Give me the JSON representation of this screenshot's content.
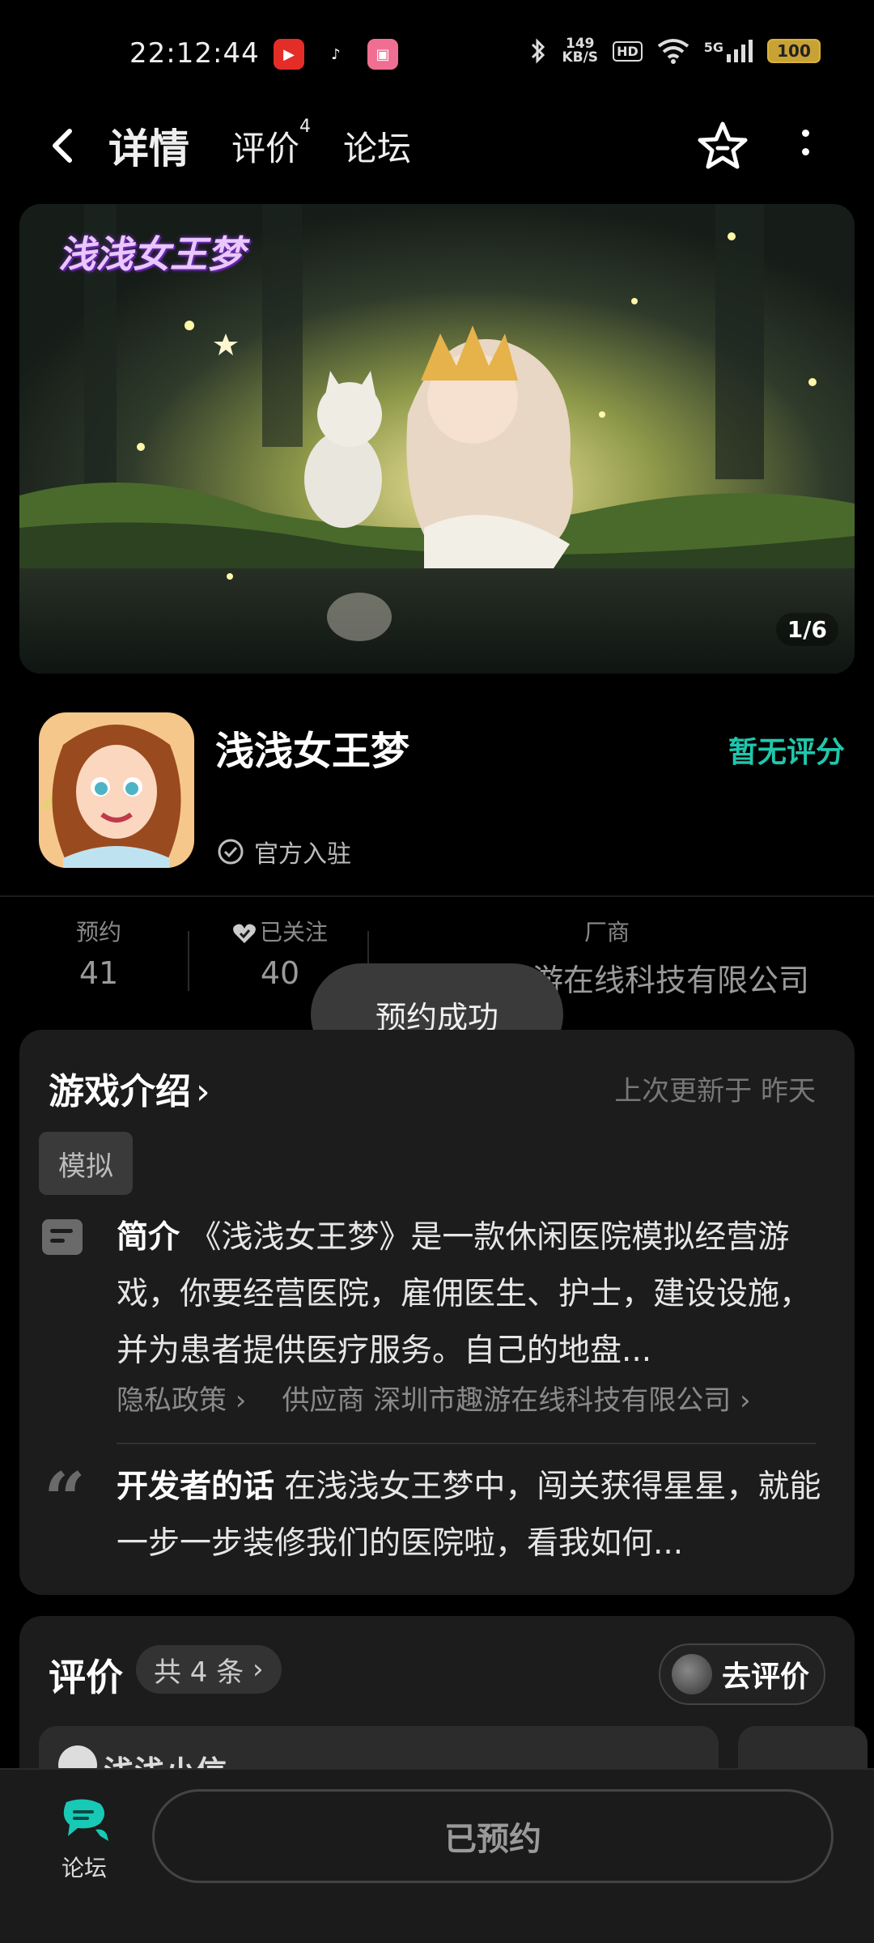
{
  "status_bar": {
    "time": "22:12:44",
    "net_speed_value": "149",
    "net_speed_unit": "KB/S",
    "hd_label": "HD",
    "signal_label": "5G",
    "battery": "100",
    "apps": [
      "youtube-icon",
      "tiktok-icon",
      "bilibili-icon"
    ]
  },
  "nav": {
    "tabs": [
      {
        "label": "详情",
        "active": true
      },
      {
        "label": "评价",
        "badge": "4"
      },
      {
        "label": "论坛"
      }
    ]
  },
  "banner": {
    "logo_text": "浅浅女王梦",
    "counter": "1/6"
  },
  "app": {
    "name": "浅浅女王梦",
    "rating": "暂无评分",
    "official": "官方入驻"
  },
  "stats": {
    "reserve_label": "预约",
    "reserve_value": "41",
    "follow_label": "已关注",
    "follow_value": "40",
    "vendor_label": "厂商",
    "vendor_value": "趣游在线科技有限公司"
  },
  "toast": "预约成功",
  "intro": {
    "title": "游戏介绍",
    "updated": "上次更新于 昨天",
    "tag": "模拟",
    "desc_label": "简介",
    "desc_text": "《浅浅女王梦》是一款休闲医院模拟经营游戏，你要经营医院，雇佣医生、护士，建设设施，并为患者提供医疗服务。自己的地盘...",
    "privacy_link": "隐私政策",
    "supplier_link": "供应商 深圳市趣游在线科技有限公司",
    "dev_label": "开发者的话",
    "dev_text": "在浅浅女王梦中，闯关获得星星，就能一步一步装修我们的医院啦，看我如何..."
  },
  "reviews": {
    "title": "评价",
    "count": "共 4 条",
    "button": "去评价",
    "first_user": "浅浅小信"
  },
  "bottom": {
    "forum_label": "论坛",
    "reserve_btn": "已预约"
  },
  "colors": {
    "accent": "#18c9b5",
    "rating": "#20c7ad",
    "background": "#000000",
    "card": "#1c1c1c"
  }
}
